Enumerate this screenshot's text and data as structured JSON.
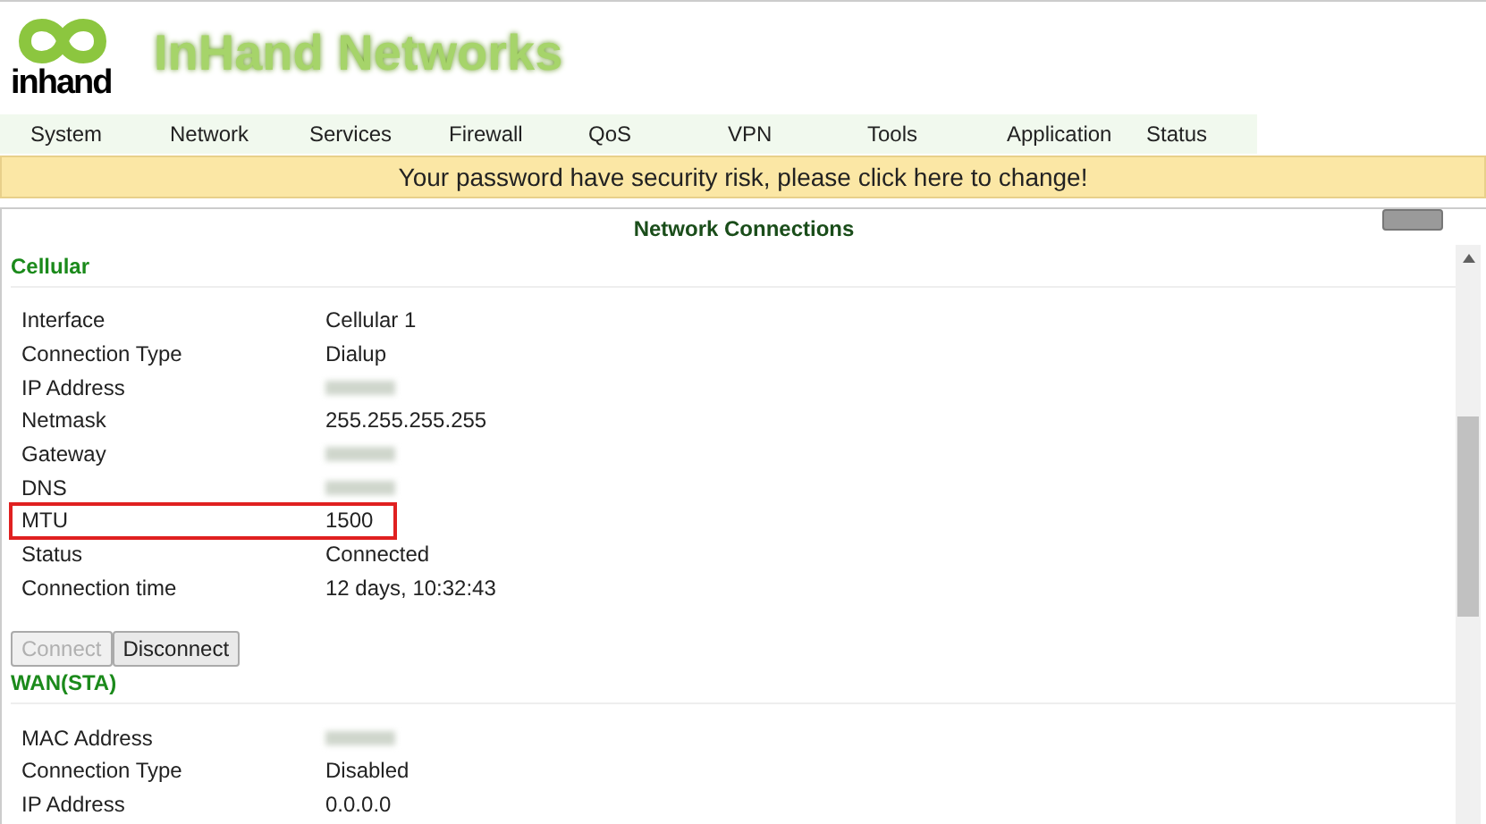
{
  "header": {
    "logo_text": "inhand",
    "brand": "InHand Networks"
  },
  "nav": [
    {
      "label": "System"
    },
    {
      "label": "Network"
    },
    {
      "label": "Services"
    },
    {
      "label": "Firewall"
    },
    {
      "label": "QoS"
    },
    {
      "label": "VPN"
    },
    {
      "label": "Tools"
    },
    {
      "label": "Application"
    },
    {
      "label": "Status"
    }
  ],
  "banner": "Your password have security risk, please click here to change!",
  "panel": {
    "title": "Network Connections",
    "sections": [
      {
        "title": "Cellular",
        "rows": [
          {
            "label": "Interface",
            "value": "Cellular 1"
          },
          {
            "label": "Connection Type",
            "value": "Dialup"
          },
          {
            "label": "IP Address",
            "kind": "redacted"
          },
          {
            "label": "Netmask",
            "value": "255.255.255.255"
          },
          {
            "label": "Gateway",
            "kind": "redacted"
          },
          {
            "label": "DNS",
            "kind": "redacted"
          },
          {
            "label": "MTU",
            "value": "1500",
            "highlighted": true
          },
          {
            "label": "Status",
            "value": "Connected"
          },
          {
            "label": "Connection time",
            "value": "12 days, 10:32:43"
          }
        ],
        "buttons": [
          {
            "label": "Connect",
            "disabled": true
          },
          {
            "label": "Disconnect",
            "disabled": false
          }
        ]
      },
      {
        "title": "WAN(STA)",
        "rows": [
          {
            "label": "MAC Address",
            "kind": "redacted"
          },
          {
            "label": "Connection Type",
            "value": "Disabled"
          },
          {
            "label": "IP Address",
            "value": "0.0.0.0"
          }
        ]
      }
    ]
  }
}
